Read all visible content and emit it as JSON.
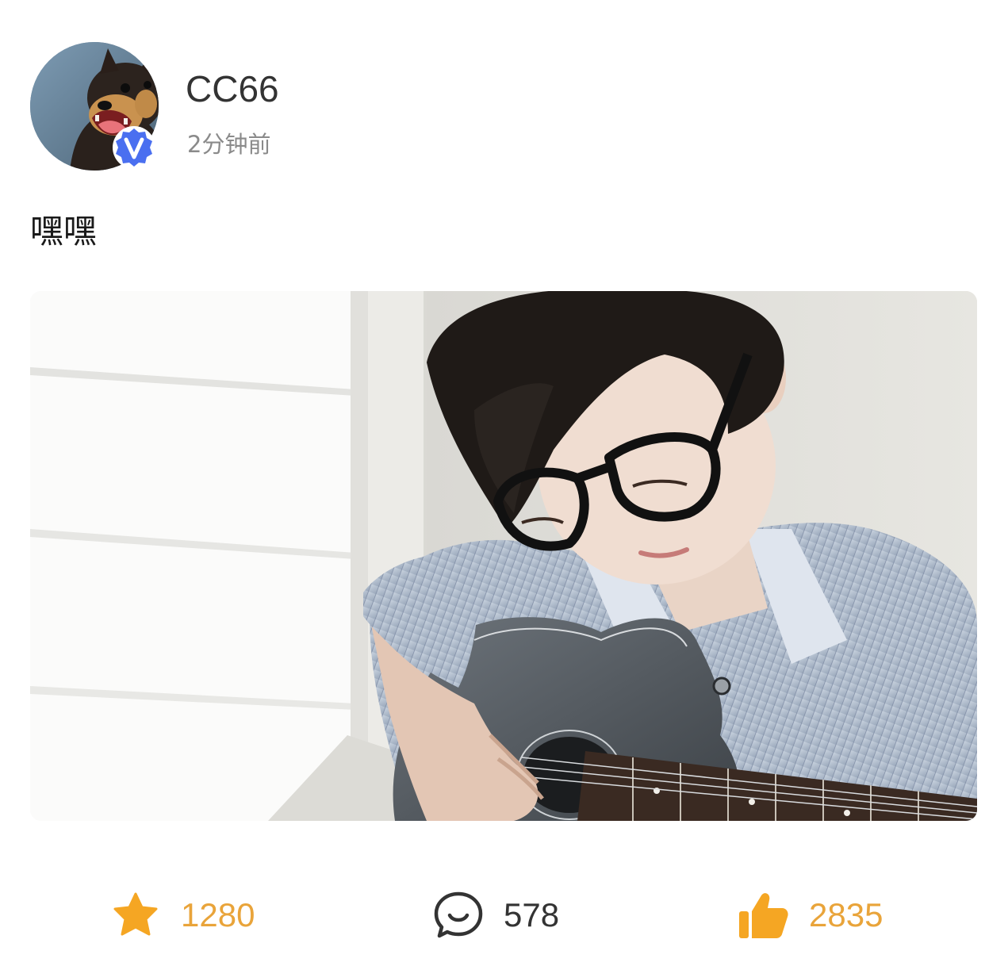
{
  "author": {
    "name": "CC66",
    "time": "2分钟前",
    "verified": true
  },
  "post": {
    "text": "嘿嘿"
  },
  "actions": {
    "favorite": {
      "icon": "star-icon",
      "count": "1280"
    },
    "comment": {
      "icon": "comment-icon",
      "count": "578"
    },
    "like": {
      "icon": "thumbs-up-icon",
      "count": "2835"
    }
  },
  "colors": {
    "accent": "#f5a623",
    "count_accent": "#e9a43a",
    "count_neutral": "#333333",
    "verified_badge": "#4a6ff0"
  }
}
